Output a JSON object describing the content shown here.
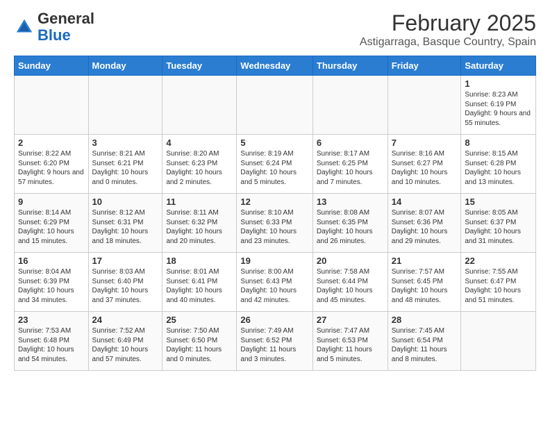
{
  "header": {
    "logo_general": "General",
    "logo_blue": "Blue",
    "main_title": "February 2025",
    "subtitle": "Astigarraga, Basque Country, Spain"
  },
  "days_of_week": [
    "Sunday",
    "Monday",
    "Tuesday",
    "Wednesday",
    "Thursday",
    "Friday",
    "Saturday"
  ],
  "weeks": [
    [
      {
        "day": "",
        "info": "",
        "empty": true
      },
      {
        "day": "",
        "info": "",
        "empty": true
      },
      {
        "day": "",
        "info": "",
        "empty": true
      },
      {
        "day": "",
        "info": "",
        "empty": true
      },
      {
        "day": "",
        "info": "",
        "empty": true
      },
      {
        "day": "",
        "info": "",
        "empty": true
      },
      {
        "day": "1",
        "info": "Sunrise: 8:23 AM\nSunset: 6:19 PM\nDaylight: 9 hours and 55 minutes."
      }
    ],
    [
      {
        "day": "2",
        "info": "Sunrise: 8:22 AM\nSunset: 6:20 PM\nDaylight: 9 hours and 57 minutes."
      },
      {
        "day": "3",
        "info": "Sunrise: 8:21 AM\nSunset: 6:21 PM\nDaylight: 10 hours and 0 minutes."
      },
      {
        "day": "4",
        "info": "Sunrise: 8:20 AM\nSunset: 6:23 PM\nDaylight: 10 hours and 2 minutes."
      },
      {
        "day": "5",
        "info": "Sunrise: 8:19 AM\nSunset: 6:24 PM\nDaylight: 10 hours and 5 minutes."
      },
      {
        "day": "6",
        "info": "Sunrise: 8:17 AM\nSunset: 6:25 PM\nDaylight: 10 hours and 7 minutes."
      },
      {
        "day": "7",
        "info": "Sunrise: 8:16 AM\nSunset: 6:27 PM\nDaylight: 10 hours and 10 minutes."
      },
      {
        "day": "8",
        "info": "Sunrise: 8:15 AM\nSunset: 6:28 PM\nDaylight: 10 hours and 13 minutes."
      }
    ],
    [
      {
        "day": "9",
        "info": "Sunrise: 8:14 AM\nSunset: 6:29 PM\nDaylight: 10 hours and 15 minutes."
      },
      {
        "day": "10",
        "info": "Sunrise: 8:12 AM\nSunset: 6:31 PM\nDaylight: 10 hours and 18 minutes."
      },
      {
        "day": "11",
        "info": "Sunrise: 8:11 AM\nSunset: 6:32 PM\nDaylight: 10 hours and 20 minutes."
      },
      {
        "day": "12",
        "info": "Sunrise: 8:10 AM\nSunset: 6:33 PM\nDaylight: 10 hours and 23 minutes."
      },
      {
        "day": "13",
        "info": "Sunrise: 8:08 AM\nSunset: 6:35 PM\nDaylight: 10 hours and 26 minutes."
      },
      {
        "day": "14",
        "info": "Sunrise: 8:07 AM\nSunset: 6:36 PM\nDaylight: 10 hours and 29 minutes."
      },
      {
        "day": "15",
        "info": "Sunrise: 8:05 AM\nSunset: 6:37 PM\nDaylight: 10 hours and 31 minutes."
      }
    ],
    [
      {
        "day": "16",
        "info": "Sunrise: 8:04 AM\nSunset: 6:39 PM\nDaylight: 10 hours and 34 minutes."
      },
      {
        "day": "17",
        "info": "Sunrise: 8:03 AM\nSunset: 6:40 PM\nDaylight: 10 hours and 37 minutes."
      },
      {
        "day": "18",
        "info": "Sunrise: 8:01 AM\nSunset: 6:41 PM\nDaylight: 10 hours and 40 minutes."
      },
      {
        "day": "19",
        "info": "Sunrise: 8:00 AM\nSunset: 6:43 PM\nDaylight: 10 hours and 42 minutes."
      },
      {
        "day": "20",
        "info": "Sunrise: 7:58 AM\nSunset: 6:44 PM\nDaylight: 10 hours and 45 minutes."
      },
      {
        "day": "21",
        "info": "Sunrise: 7:57 AM\nSunset: 6:45 PM\nDaylight: 10 hours and 48 minutes."
      },
      {
        "day": "22",
        "info": "Sunrise: 7:55 AM\nSunset: 6:47 PM\nDaylight: 10 hours and 51 minutes."
      }
    ],
    [
      {
        "day": "23",
        "info": "Sunrise: 7:53 AM\nSunset: 6:48 PM\nDaylight: 10 hours and 54 minutes."
      },
      {
        "day": "24",
        "info": "Sunrise: 7:52 AM\nSunset: 6:49 PM\nDaylight: 10 hours and 57 minutes."
      },
      {
        "day": "25",
        "info": "Sunrise: 7:50 AM\nSunset: 6:50 PM\nDaylight: 11 hours and 0 minutes."
      },
      {
        "day": "26",
        "info": "Sunrise: 7:49 AM\nSunset: 6:52 PM\nDaylight: 11 hours and 3 minutes."
      },
      {
        "day": "27",
        "info": "Sunrise: 7:47 AM\nSunset: 6:53 PM\nDaylight: 11 hours and 5 minutes."
      },
      {
        "day": "28",
        "info": "Sunrise: 7:45 AM\nSunset: 6:54 PM\nDaylight: 11 hours and 8 minutes."
      },
      {
        "day": "",
        "info": "",
        "empty": true
      }
    ]
  ]
}
